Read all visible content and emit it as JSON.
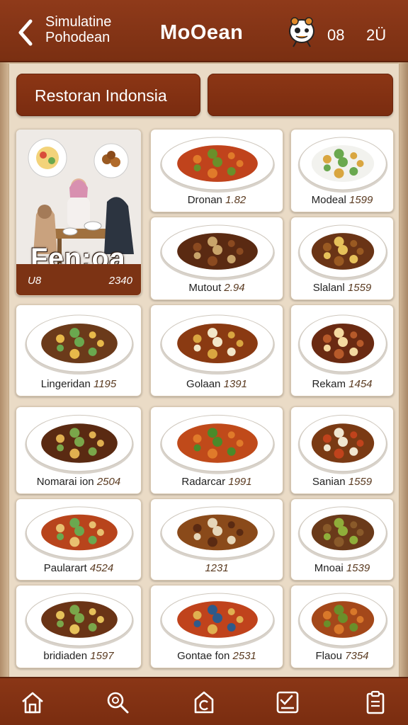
{
  "header": {
    "subtitle_line1": "Simulatine",
    "subtitle_line2": "Pohodean",
    "title": "MoOean",
    "stat_1": "08",
    "stat_2": "2Ü"
  },
  "tabs": [
    {
      "label": "Restoran Indonsia"
    },
    {
      "label": ""
    }
  ],
  "featured": {
    "title": "Fen:oa",
    "small_label": "U8",
    "number": "2340"
  },
  "menu_items": [
    {
      "name": "Dronan",
      "price": "1.82"
    },
    {
      "name": "Modeal",
      "price": "1599"
    },
    {
      "name": "Mutout",
      "price": "2.94"
    },
    {
      "name": "Slalanl",
      "price": "1559"
    },
    {
      "name": "Lingeridan",
      "price": "1195"
    },
    {
      "name": "Golaan",
      "price": "1391"
    },
    {
      "name": "Rekam",
      "price": "1454"
    },
    {
      "name": "Nomarai ion",
      "price": "2504"
    },
    {
      "name": "Radarcar",
      "price": "1991"
    },
    {
      "name": "Sanian",
      "price": "1559"
    },
    {
      "name": "Paularart",
      "price": "4524"
    },
    {
      "name": "",
      "price": "1231"
    },
    {
      "name": "Mnoai",
      "price": "1539"
    },
    {
      "name": "bridiaden",
      "price": "1597"
    },
    {
      "name": "Gontae fon",
      "price": "2531"
    },
    {
      "name": "Flaou",
      "price": "7354"
    }
  ],
  "nav": [
    {
      "icon": "home-icon"
    },
    {
      "icon": "search-icon"
    },
    {
      "icon": "recipe-icon"
    },
    {
      "icon": "checklist-icon"
    },
    {
      "icon": "clipboard-icon"
    }
  ],
  "colors": {
    "header_brown": "#8f3a1a",
    "board": "#eadbc6",
    "card": "#ffffff"
  }
}
